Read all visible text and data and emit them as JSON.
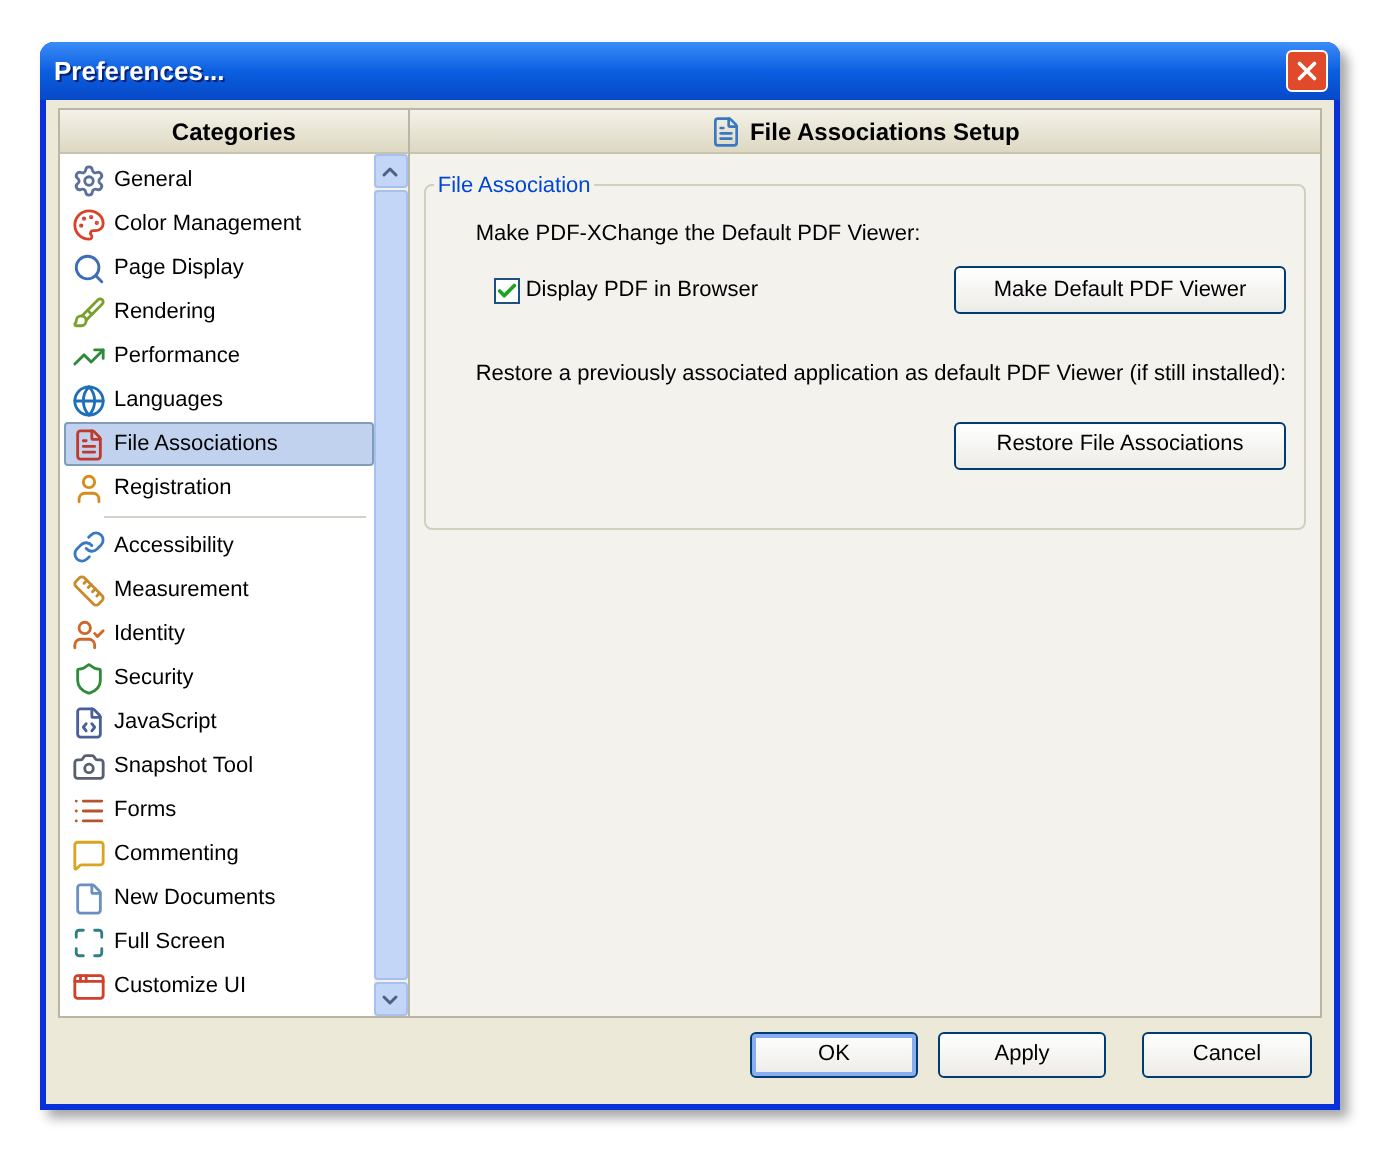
{
  "window": {
    "title": "Preferences..."
  },
  "sidebar": {
    "heading": "Categories",
    "groups": [
      [
        {
          "label": "General",
          "selected": false
        },
        {
          "label": "Color Management",
          "selected": false
        },
        {
          "label": "Page Display",
          "selected": false
        },
        {
          "label": "Rendering",
          "selected": false
        },
        {
          "label": "Performance",
          "selected": false
        },
        {
          "label": "Languages",
          "selected": false
        },
        {
          "label": "File Associations",
          "selected": true
        },
        {
          "label": "Registration",
          "selected": false
        }
      ],
      [
        {
          "label": "Accessibility",
          "selected": false
        },
        {
          "label": "Measurement",
          "selected": false
        },
        {
          "label": "Identity",
          "selected": false
        },
        {
          "label": "Security",
          "selected": false
        },
        {
          "label": "JavaScript",
          "selected": false
        },
        {
          "label": "Snapshot Tool",
          "selected": false
        },
        {
          "label": "Forms",
          "selected": false
        },
        {
          "label": "Commenting",
          "selected": false
        },
        {
          "label": "New Documents",
          "selected": false
        },
        {
          "label": "Full Screen",
          "selected": false
        },
        {
          "label": "Customize UI",
          "selected": false
        }
      ]
    ]
  },
  "panel": {
    "title": "File Associations Setup",
    "group": {
      "legend": "File Association",
      "make_default_text": "Make PDF-XChange the Default PDF Viewer:",
      "checkbox": {
        "label": "Display PDF in Browser",
        "checked": true
      },
      "make_default_button": "Make Default PDF Viewer",
      "restore_text": "Restore a previously associated application as default PDF Viewer (if still installed):",
      "restore_button": "Restore File Associations"
    }
  },
  "buttons": [
    {
      "label": "OK",
      "selected": true
    },
    {
      "label": "Apply",
      "selected": false
    },
    {
      "label": "Cancel",
      "selected": false
    }
  ]
}
